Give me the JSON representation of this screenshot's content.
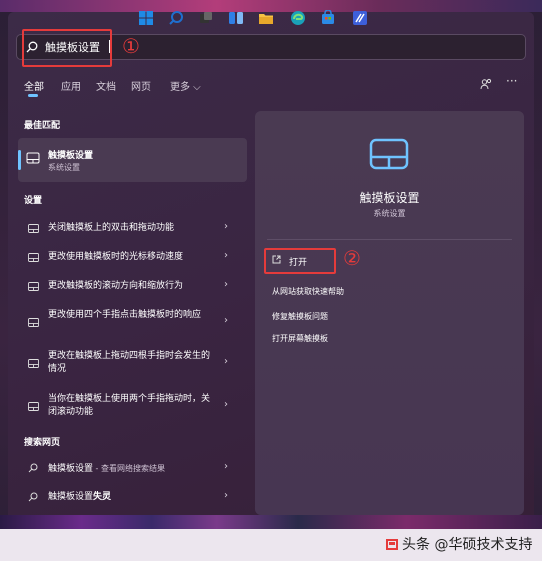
{
  "search": {
    "value": "触摸板设置",
    "annotation_1": "①"
  },
  "tabs": [
    {
      "label": "全部"
    },
    {
      "label": "应用"
    },
    {
      "label": "文档"
    },
    {
      "label": "网页"
    },
    {
      "label": "更多 ⌵"
    }
  ],
  "header_more": "···",
  "best_match": {
    "heading": "最佳匹配",
    "title": "触摸板设置",
    "subtitle": "系统设置"
  },
  "settings": {
    "heading": "设置",
    "items": [
      {
        "label": "关闭触摸板上的双击和拖动功能"
      },
      {
        "label": "更改使用触摸板时的光标移动速度"
      },
      {
        "label": "更改触摸板的滚动方向和缩放行为"
      },
      {
        "label": "更改使用四个手指点击触摸板时的响应"
      },
      {
        "label": "更改在触摸板上拖动四根手指时会发生的情况"
      },
      {
        "label": "当你在触摸板上使用两个手指拖动时，关闭滚动功能"
      }
    ]
  },
  "web": {
    "heading": "搜索网页",
    "items": [
      {
        "label": "触摸板设置",
        "suffix": " - 查看网络搜索结果"
      },
      {
        "label": "触摸板设置",
        "bold": "失灵"
      }
    ]
  },
  "detail": {
    "title": "触摸板设置",
    "subtitle": "系统设置",
    "open_label": "打开",
    "annotation_2": "②",
    "actions": [
      {
        "label": "从网站获取快速帮助"
      },
      {
        "label": "修复触摸板问题"
      },
      {
        "label": "打开屏幕触摸板"
      }
    ]
  },
  "chevron": "›",
  "watermark": "头条 @华硕技术支持",
  "colors": {
    "accent": "#6fc3ff",
    "annotation": "#e53b3b"
  }
}
